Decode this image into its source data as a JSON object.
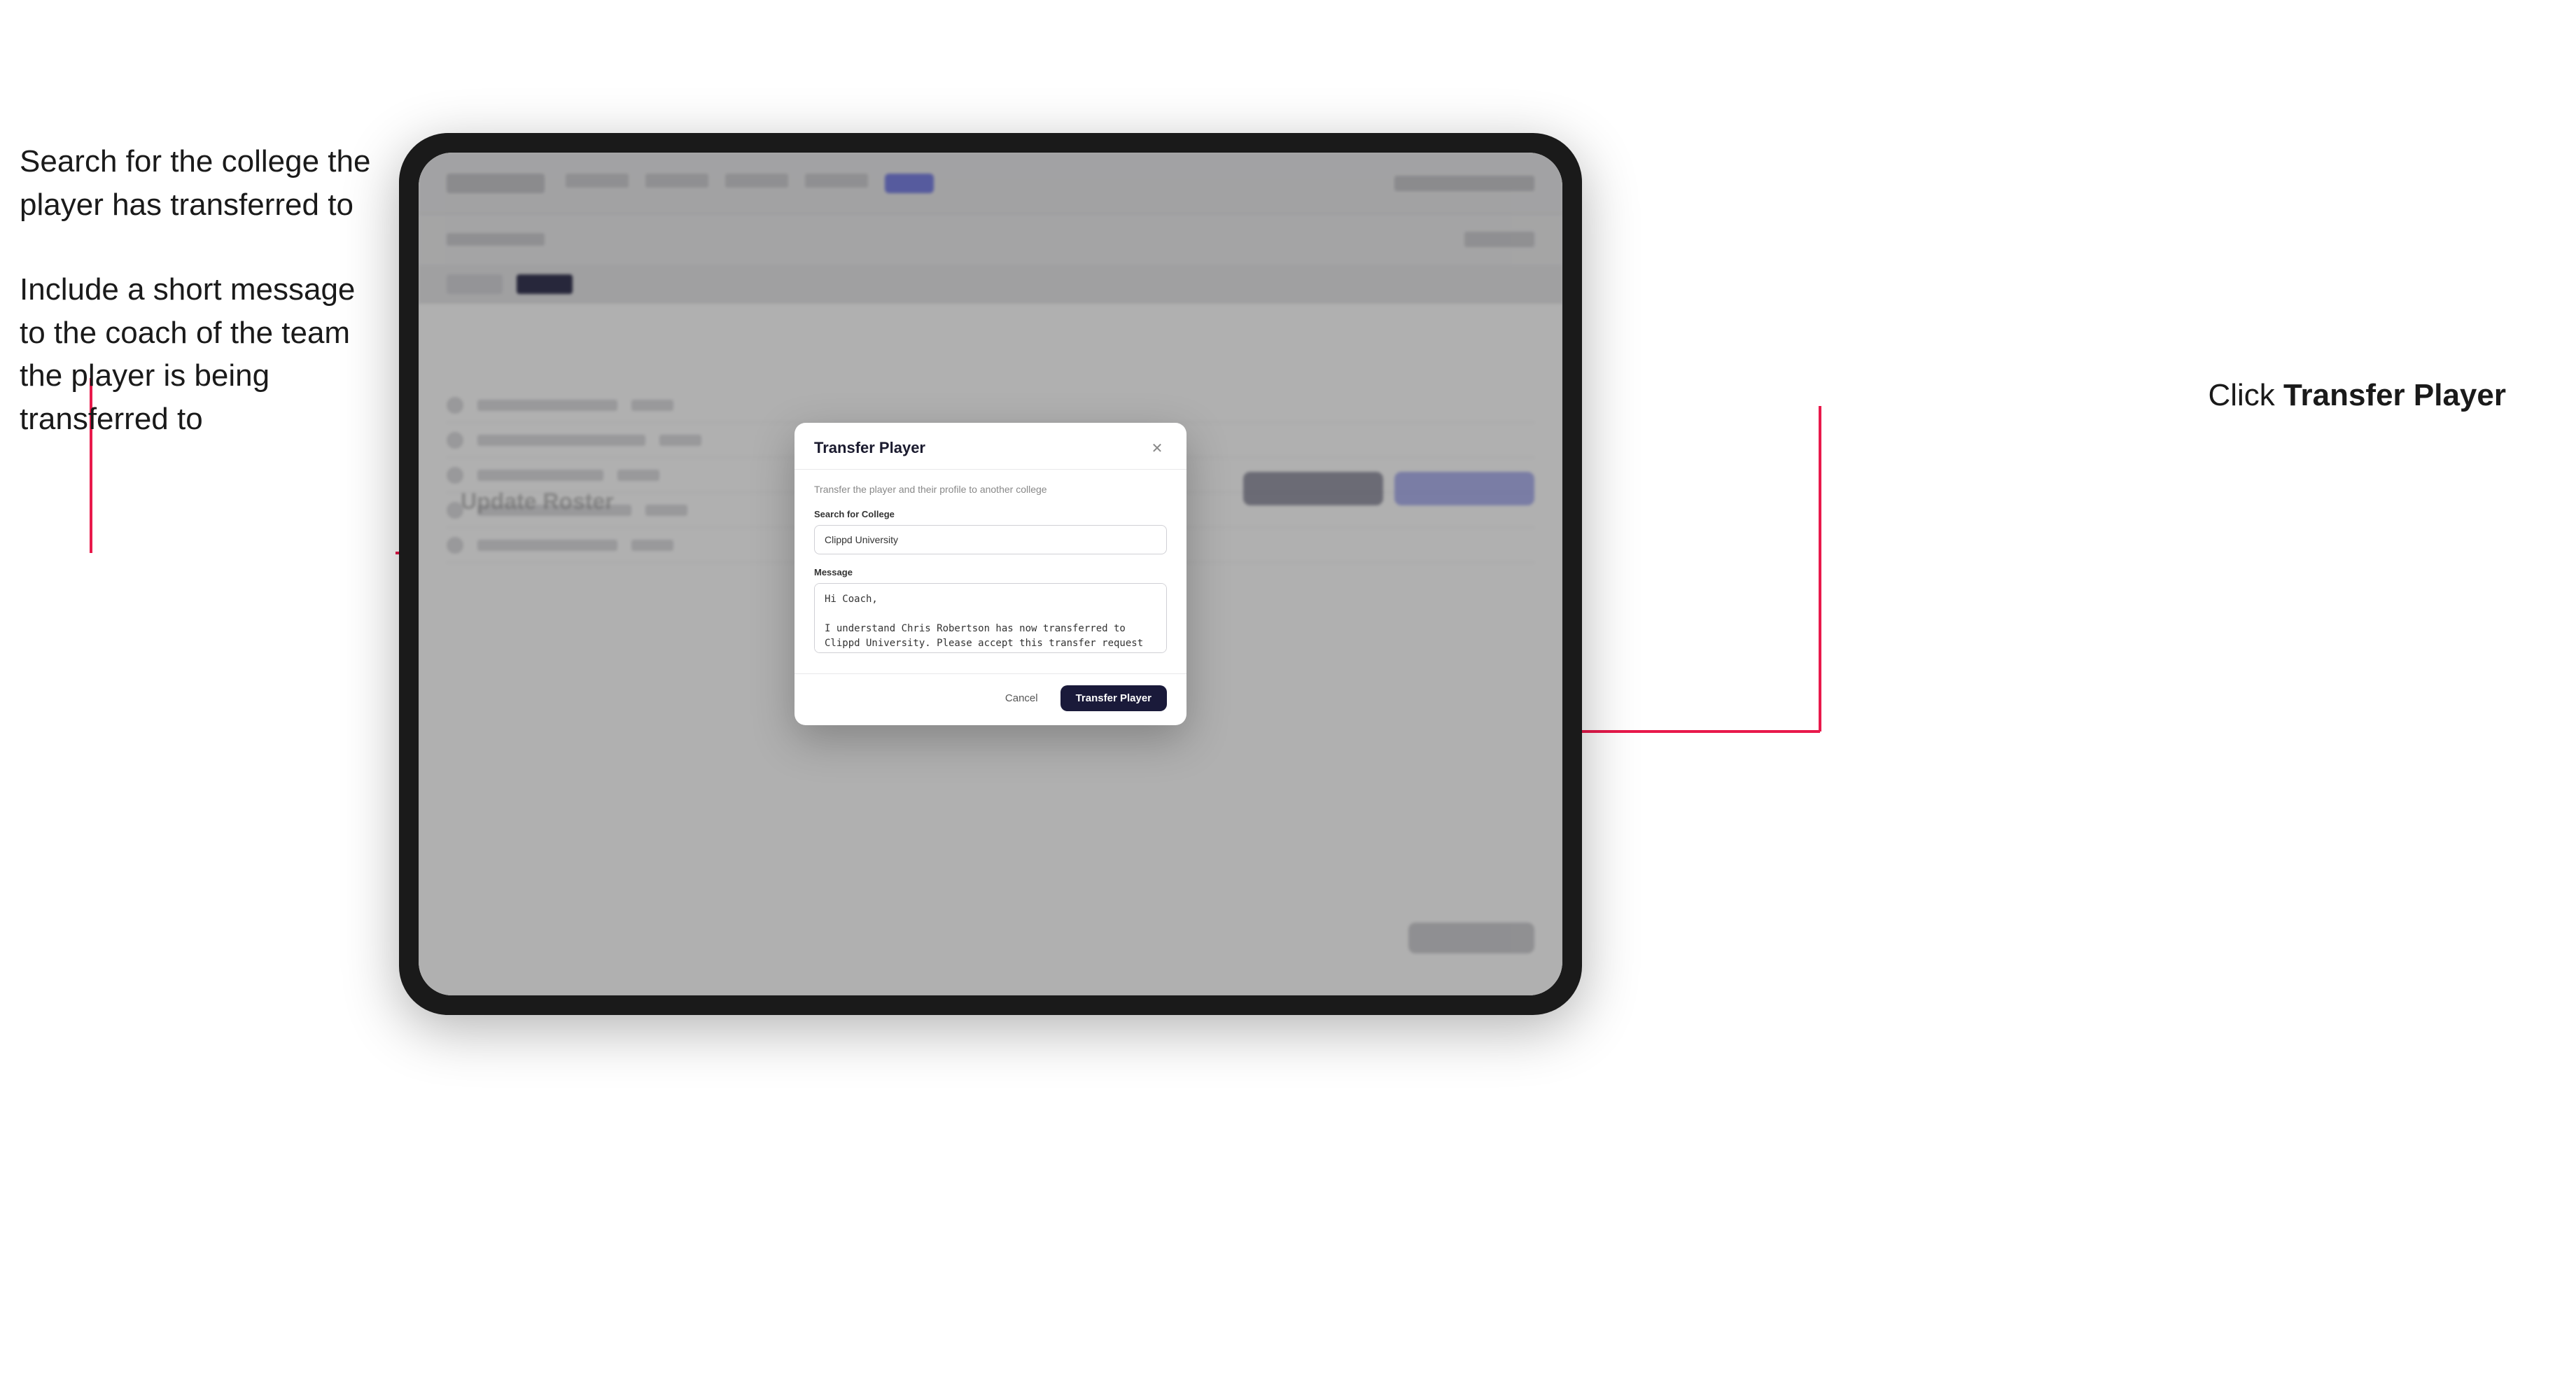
{
  "annotations": {
    "left_top": "Search for the college the player has transferred to",
    "left_bottom": "Include a short message to the coach of the team the player is being transferred to",
    "right": "Click ",
    "right_bold": "Transfer Player"
  },
  "modal": {
    "title": "Transfer Player",
    "subtitle": "Transfer the player and their profile to another college",
    "search_label": "Search for College",
    "search_value": "Clippd University",
    "message_label": "Message",
    "message_value": "Hi Coach,\n\nI understand Chris Robertson has now transferred to Clippd University. Please accept this transfer request when you can.",
    "cancel_label": "Cancel",
    "transfer_label": "Transfer Player"
  },
  "page": {
    "update_roster": "Update Roster"
  },
  "colors": {
    "transfer_button_bg": "#1a1a3a",
    "accent": "#6870e0",
    "arrow": "#e8194b"
  }
}
